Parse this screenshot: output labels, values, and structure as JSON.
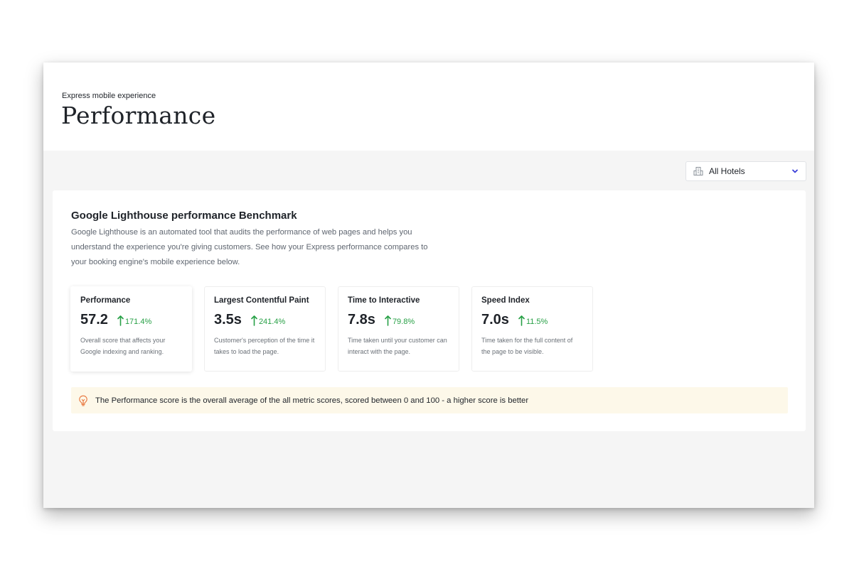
{
  "header": {
    "eyebrow": "Express mobile experience",
    "title": "Performance"
  },
  "filter": {
    "selected": "All Hotels",
    "icon": "hotel-building-icon"
  },
  "benchmark": {
    "title": "Google Lighthouse performance Benchmark",
    "description": "Google Lighthouse is an automated tool that audits the performance of web pages and helps you understand the experience you're giving customers. See how your Express performance compares to your booking engine's mobile experience below.",
    "metrics": [
      {
        "name": "Performance",
        "value": "57.2",
        "change": "171.4%",
        "trend": "up",
        "description": "Overall score that affects your Google indexing and ranking.",
        "active": true
      },
      {
        "name": "Largest Contentful Paint",
        "value": "3.5s",
        "change": "241.4%",
        "trend": "up",
        "description": "Customer's perception of the time it takes to load the page.",
        "active": false
      },
      {
        "name": "Time to Interactive",
        "value": "7.8s",
        "change": "79.8%",
        "trend": "up",
        "description": "Time taken until your customer can interact with the page.",
        "active": false
      },
      {
        "name": "Speed Index",
        "value": "7.0s",
        "change": "11.5%",
        "trend": "up",
        "description": "Time taken for the full content of the page to be visible.",
        "active": false
      }
    ],
    "info": {
      "icon": "lightbulb-icon",
      "text": "The Performance score is the overall average of the all metric scores, scored between 0 and 100 - a higher score is better"
    }
  },
  "colors": {
    "positive": "#27a046",
    "info_background": "#fdf8e9",
    "info_icon": "#e8743b",
    "accent": "#3b3fd8"
  }
}
